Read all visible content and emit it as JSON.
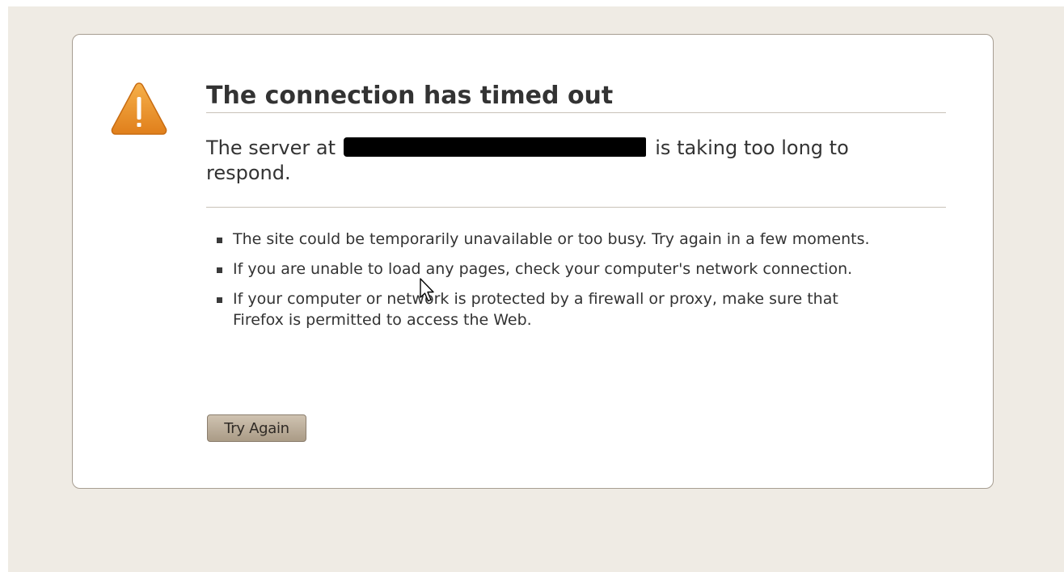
{
  "error": {
    "title": "The connection has timed out",
    "short_desc": {
      "before": "The server at",
      "after": "is taking too long to respond."
    },
    "long_desc": [
      "The site could be temporarily unavailable or too busy. Try again in a few moments.",
      "If you are unable to load any pages, check your computer's network connection.",
      "If your computer or network is protected by a firewall or proxy, make sure that Firefox is permitted to access the Web."
    ],
    "try_again_label": "Try Again"
  },
  "icons": {
    "warning": "warning-icon",
    "cursor": "mouse-pointer-icon"
  },
  "colors": {
    "page_background": "#efebe4",
    "box_border": "#a79e92",
    "warning_fill": "#e8922a",
    "button_fill": "#bcae99"
  }
}
